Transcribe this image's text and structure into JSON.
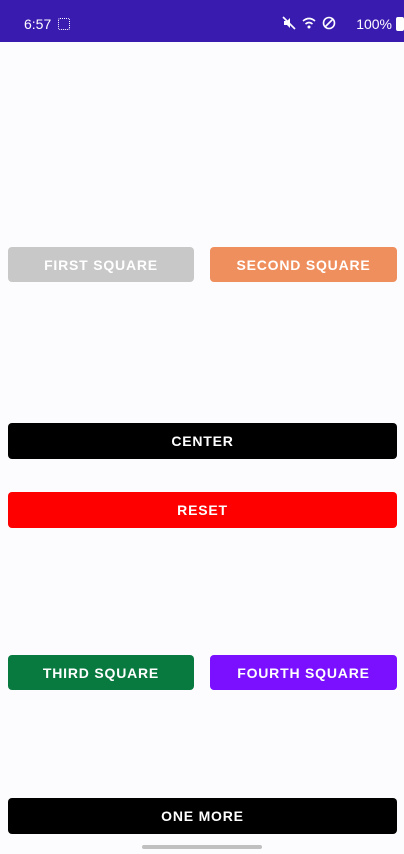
{
  "status_bar": {
    "time": "6:57",
    "battery_percent": "100%",
    "icons": [
      "screen-record-icon",
      "mute-icon",
      "wifi-icon",
      "dnd-icon",
      "battery-icon"
    ],
    "color": "#3a1bb0"
  },
  "buttons": {
    "first_square": {
      "label": "FIRST SQUARE",
      "color": "#c8c8c8"
    },
    "second_square": {
      "label": "SECOND SQUARE",
      "color": "#f08f5e"
    },
    "center": {
      "label": "CENTER",
      "color": "#000000"
    },
    "reset": {
      "label": "RESET",
      "color": "#ff0000"
    },
    "third_square": {
      "label": "THIRD SQUARE",
      "color": "#087a40"
    },
    "fourth_square": {
      "label": "FOURTH SQUARE",
      "color": "#7a10ff"
    },
    "one_more": {
      "label": "ONE MORE",
      "color": "#000000"
    }
  }
}
